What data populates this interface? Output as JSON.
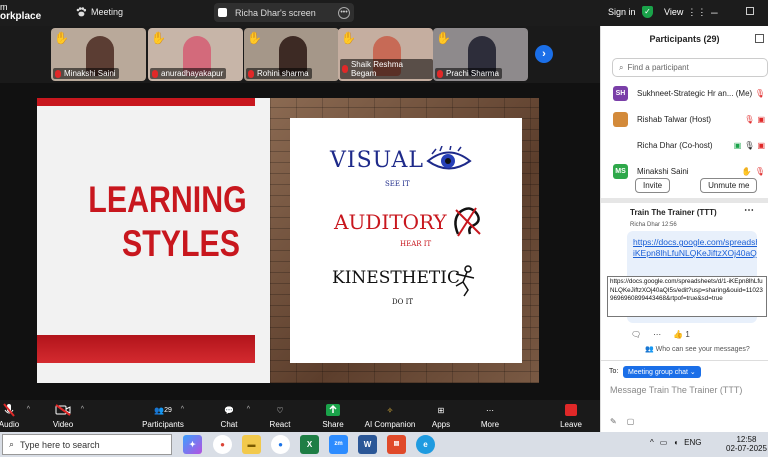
{
  "topbar": {
    "brand_line1": "m",
    "brand_line2": "orkplace",
    "meeting_label": "Meeting",
    "share_title": "Richa Dhar's screen",
    "sign_in": "Sign in",
    "view": "View"
  },
  "gallery": {
    "tiles": [
      {
        "name": "Minakshi Saini",
        "bg": "#b9a99a",
        "person": "#5b3d33"
      },
      {
        "name": "anuradhayakapur",
        "bg": "#c7b5a8",
        "person": "#d36a7b"
      },
      {
        "name": "Rohini sharma",
        "bg": "#a59789",
        "person": "#3d2a24"
      },
      {
        "name": "Shaik Reshma Begam",
        "bg": "#c5aea0",
        "person": "#c76a56"
      },
      {
        "name": "Prachi Sharma",
        "bg": "#8e8a8c",
        "person": "#2d2d3a"
      }
    ]
  },
  "slide": {
    "title_line1": "LEARNING",
    "title_line2": "STYLES",
    "visual": "VISUAL",
    "visual_sub": "SEE IT",
    "auditory": "AUDITORY",
    "auditory_sub": "HEAR IT",
    "kinesthetic": "KINESTHETIC",
    "kinesthetic_sub": "DO IT"
  },
  "toolbar": {
    "audio": "Audio",
    "video": "Video",
    "participants": "Participants",
    "participants_count": "29",
    "chat": "Chat",
    "react": "React",
    "share": "Share",
    "ai": "AI Companion",
    "apps": "Apps",
    "more": "More",
    "leave": "Leave"
  },
  "panel": {
    "title": "Participants (29)",
    "search_placeholder": "Find a participant",
    "participants": [
      {
        "initials": "SH",
        "color": "#7a3fa8",
        "name": "Sukhneet-Strategic Hr an...",
        "suffix": "(Me)"
      },
      {
        "initials": "",
        "color": "#d38a3a",
        "name": "Rishab Talwar (Host)",
        "suffix": ""
      },
      {
        "initials": "",
        "color": "#ffffff",
        "name": "Richa Dhar (Co-host)",
        "suffix": ""
      },
      {
        "initials": "MS",
        "color": "#2ea84a",
        "name": "Minakshi Saini",
        "suffix": ""
      }
    ],
    "invite": "Invite",
    "unmute_me": "Unmute me",
    "chat_title": "Train The Trainer (TTT)",
    "sender": "Richa Dhar  12:56",
    "link": "https://docs.google.com/spreadsheets/d/1-iKEpn8lhLfuNLQKeJiftzXOj40aQ...",
    "tooltip": "https://docs.google.com/spreadsheets/d/1-iKEpn8lhLfuNLQKeJiftzXOj40aQI5s/edit?usp=sharing&ouid=110239696960899443468&rtpof=true&sd=true",
    "reaction_count": "1",
    "visibility": "Who can see your messages?",
    "to_label": "To:",
    "to_target": "Meeting group chat",
    "message_placeholder": "Message Train The Trainer (TTT)"
  },
  "taskbar": {
    "search": "Type here to search",
    "lang": "ENG",
    "time": "12:58",
    "date": "02-07-2025"
  }
}
